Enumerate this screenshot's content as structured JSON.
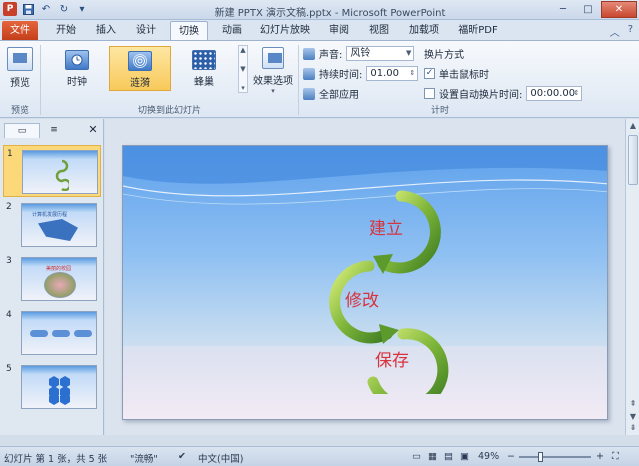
{
  "window": {
    "title": "新建 PPTX 演示文稿.pptx - Microsoft PowerPoint",
    "app_letter": "P",
    "buttons": {
      "minimize": "─",
      "maximize": "□",
      "close": "✕"
    }
  },
  "tabs": [
    {
      "label": "文件"
    },
    {
      "label": "开始"
    },
    {
      "label": "插入"
    },
    {
      "label": "设计"
    },
    {
      "label": "切换"
    },
    {
      "label": "动画"
    },
    {
      "label": "幻灯片放映"
    },
    {
      "label": "审阅"
    },
    {
      "label": "视图"
    },
    {
      "label": "加载项"
    },
    {
      "label": "福昕PDF"
    }
  ],
  "ribbon": {
    "preview": {
      "button": "预览",
      "group": "预览"
    },
    "transitions": {
      "group": "切换到此幻灯片",
      "items": [
        {
          "label": "时钟"
        },
        {
          "label": "涟漪",
          "selected": true
        },
        {
          "label": "蜂巢"
        }
      ],
      "effect_options": "效果选项"
    },
    "timing": {
      "group": "计时",
      "sound_label": "声音:",
      "sound_value": "风铃",
      "duration_label": "持续时间:",
      "duration_value": "01.00",
      "apply_all": "全部应用",
      "advance_title": "换片方式",
      "on_click": "单击鼠标时",
      "on_click_checked": true,
      "after_label": "设置自动换片时间:",
      "after_checked": false,
      "after_value": "00:00.00"
    }
  },
  "slides_panel": {
    "slides": [
      {
        "num": "1",
        "selected": true
      },
      {
        "num": "2",
        "title": "计算机发展历程"
      },
      {
        "num": "3",
        "title": "美丽的校园"
      },
      {
        "num": "4"
      },
      {
        "num": "5"
      }
    ]
  },
  "slide": {
    "words": [
      "建立",
      "修改",
      "保存"
    ]
  },
  "statusbar": {
    "slide_info": "幻灯片 第 1 张，共 5 张",
    "theme": "\"流畅\"",
    "language": "中文(中国)",
    "zoom": "49%"
  },
  "colors": {
    "file_tab": "#d2491f",
    "selected_gallery": "#f8c95a",
    "slide_text": "#d8323c"
  }
}
